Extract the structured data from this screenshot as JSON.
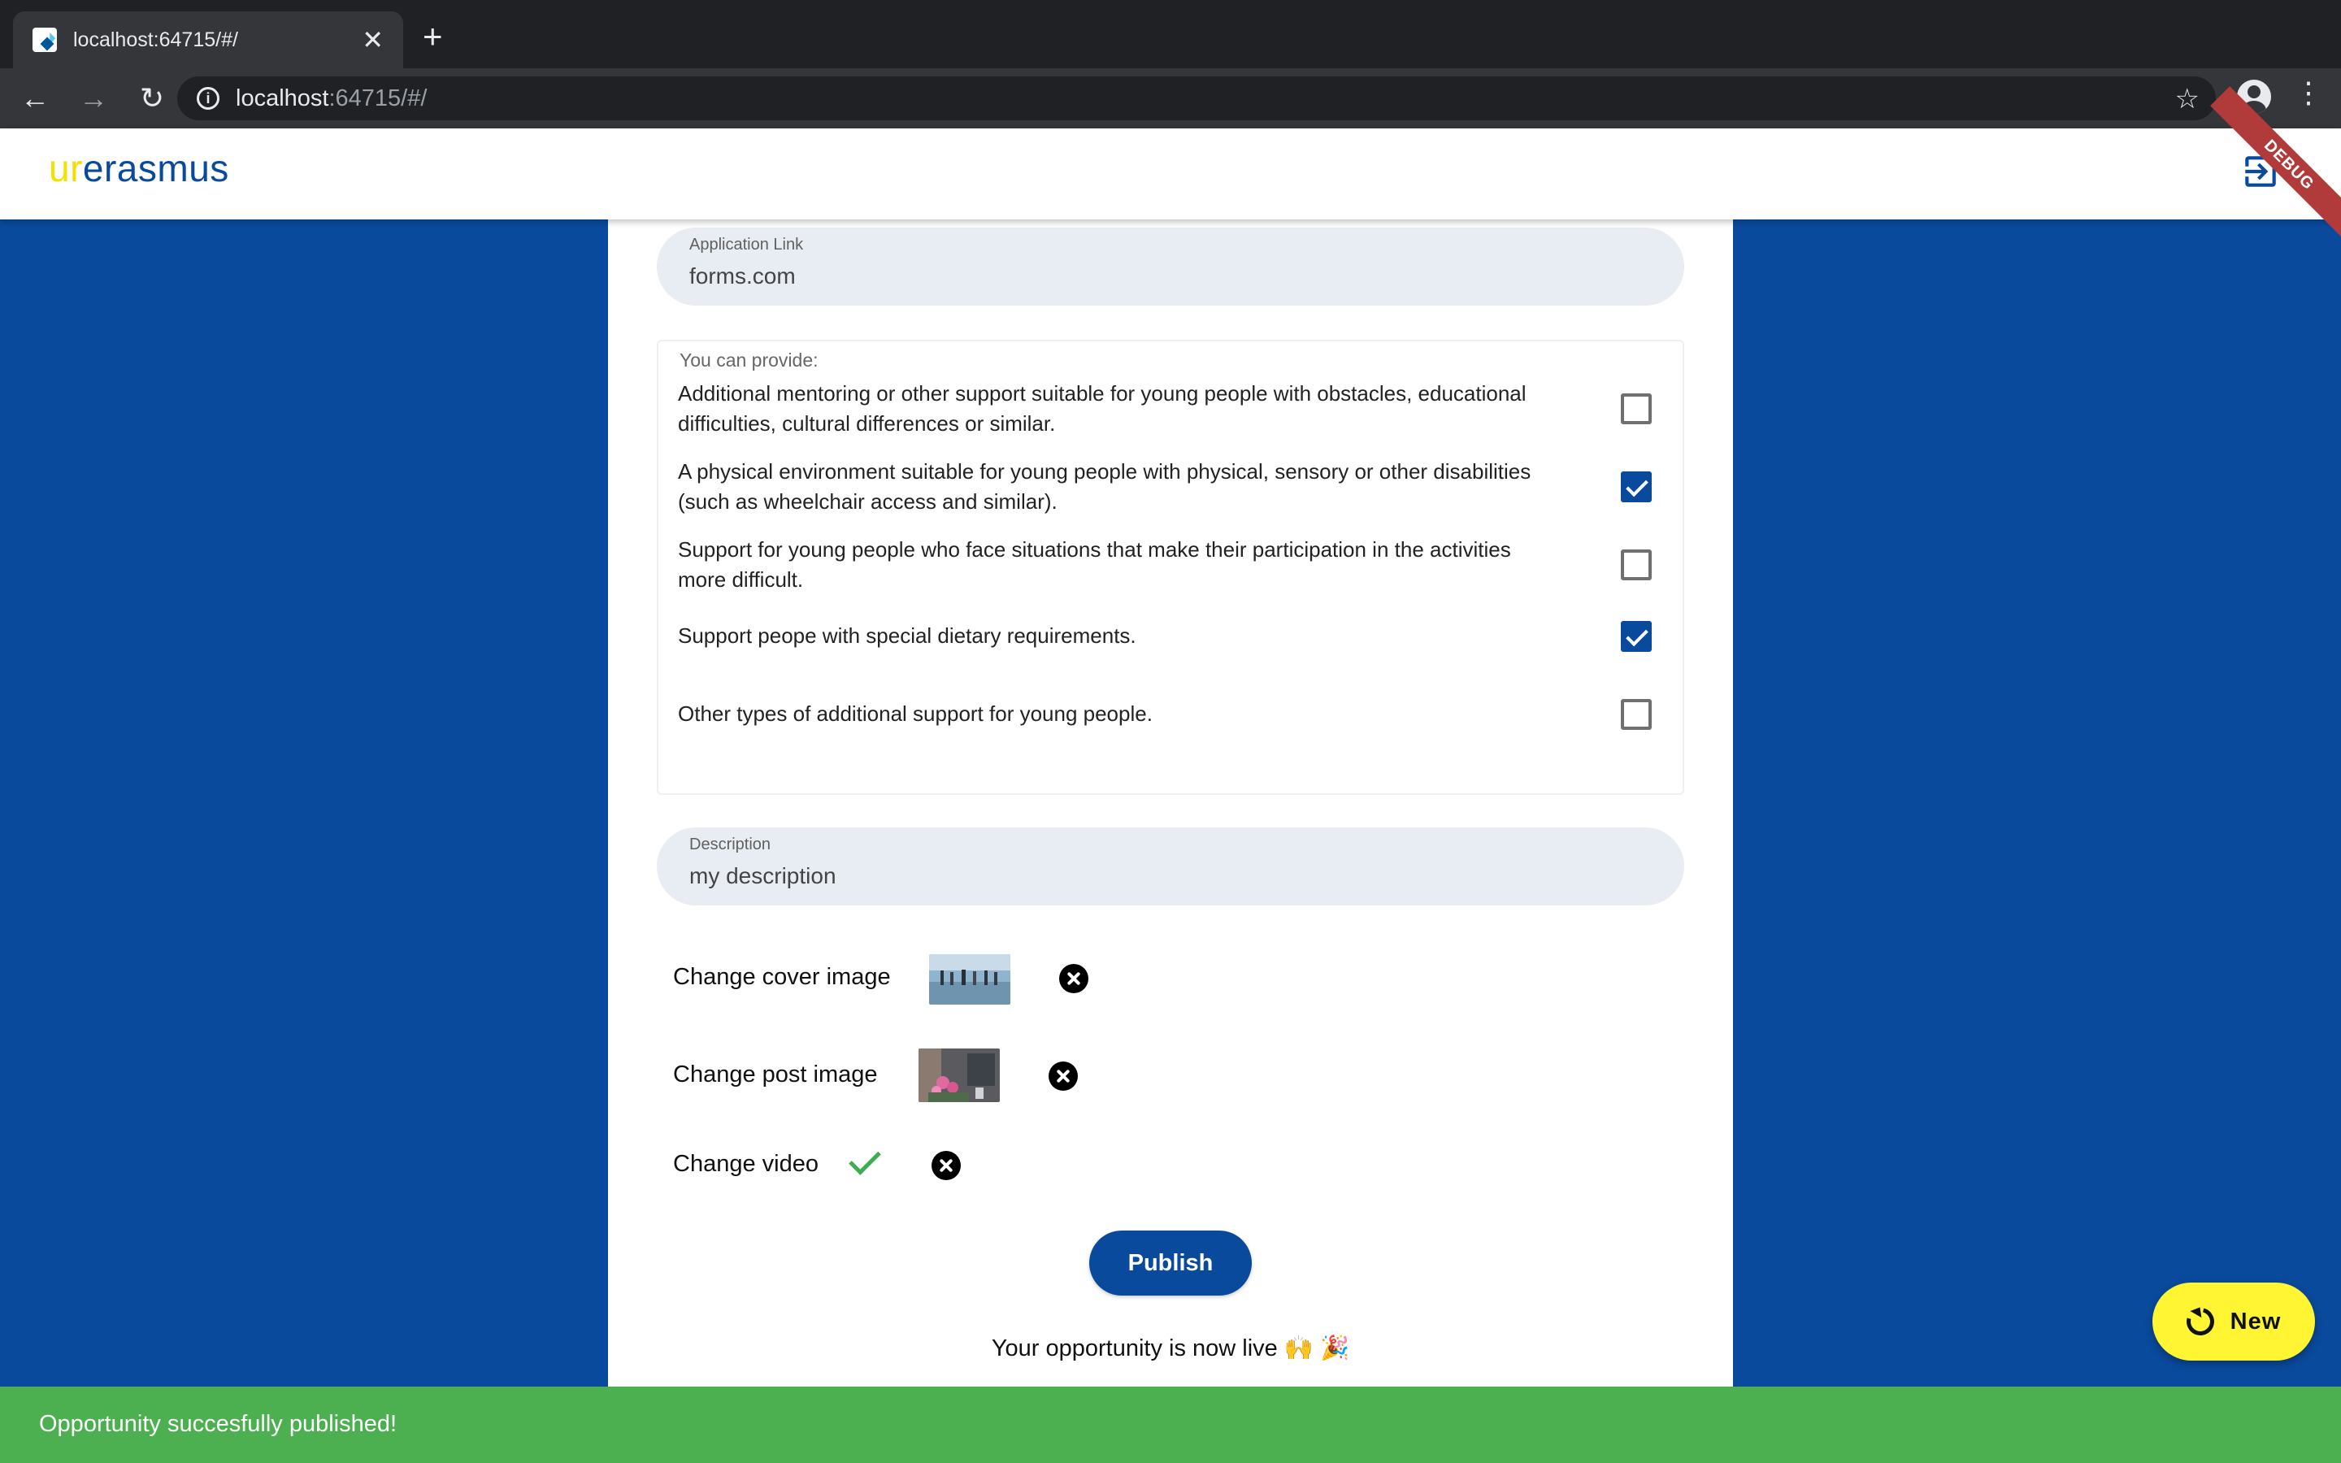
{
  "browser": {
    "tab_title": "localhost:64715/#/",
    "url_host": "localhost",
    "url_rest": ":64715/#/"
  },
  "app": {
    "logo_ur": "ur",
    "logo_erasmus": "erasmus",
    "debug_label": "DEBUG",
    "logout_icon": "logout-icon"
  },
  "form": {
    "application_link": {
      "label": "Application Link",
      "value": "forms.com"
    },
    "provide": {
      "legend": "You can provide:",
      "options": [
        {
          "label": "Additional mentoring or other support suitable for young people with obstacles, educational difficulties, cultural differences or similar.",
          "checked": false
        },
        {
          "label": "A physical environment suitable for young people with physical, sensory or other disabilities (such as wheelchair access and similar).",
          "checked": true
        },
        {
          "label": "Support for young people who face situations that make their participation in the activities more difficult.",
          "checked": false
        },
        {
          "label": "Support peope with special dietary requirements.",
          "checked": true
        },
        {
          "label": "Other types of additional support for young people.",
          "checked": false
        }
      ]
    },
    "description": {
      "label": "Description",
      "value": "my description"
    },
    "media": {
      "cover_label": "Change cover image",
      "post_label": "Change post image",
      "video_label": "Change video"
    },
    "publish_label": "Publish",
    "live_message": "Your opportunity is now live 🙌 🎉"
  },
  "fab": {
    "label": "New"
  },
  "snackbar": {
    "message": "Opportunity succesfully published!"
  },
  "colors": {
    "brand_blue": "#0a4a9c",
    "brand_yellow": "#f4e000",
    "success_green": "#4caf50",
    "fab_yellow": "#fff533"
  }
}
